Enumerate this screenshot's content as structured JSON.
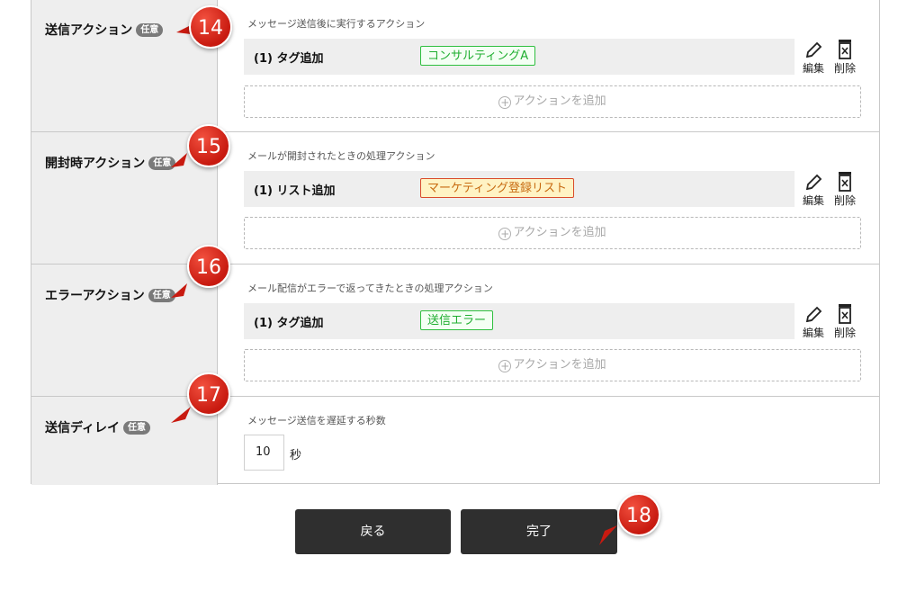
{
  "rows": [
    {
      "label": "送信アクション",
      "badge": "任意",
      "description": "メッセージ送信後に実行するアクション",
      "action_name": "(1) タグ追加",
      "tag": "コンサルティングA",
      "tag_color": "green",
      "edit_label": "編集",
      "delete_label": "削除",
      "add_label": "アクションを追加",
      "marker": "14"
    },
    {
      "label": "開封時アクション",
      "badge": "任意",
      "description": "メールが開封されたときの処理アクション",
      "action_name": "(1) リスト追加",
      "tag": "マーケティング登録リスト",
      "tag_color": "orange",
      "edit_label": "編集",
      "delete_label": "削除",
      "add_label": "アクションを追加",
      "marker": "15"
    },
    {
      "label": "エラーアクション",
      "badge": "任意",
      "description": "メール配信がエラーで返ってきたときの処理アクション",
      "action_name": "(1) タグ追加",
      "tag": "送信エラー",
      "tag_color": "green",
      "edit_label": "編集",
      "delete_label": "削除",
      "add_label": "アクションを追加",
      "marker": "16"
    }
  ],
  "delay": {
    "label": "送信ディレイ",
    "badge": "任意",
    "description": "メッセージ送信を遅延する秒数",
    "value": "10",
    "unit": "秒",
    "marker": "17"
  },
  "buttons": {
    "back": "戻る",
    "done": "完了",
    "marker": "18"
  },
  "colors": {
    "marker_red": "#d3261a",
    "tag_green": "#1fae30",
    "tag_orange_bg": "#fff3c4",
    "button_dark": "#2f2f2f"
  },
  "icons": [
    "pencil-icon",
    "trash-icon",
    "plus-circle-icon"
  ]
}
